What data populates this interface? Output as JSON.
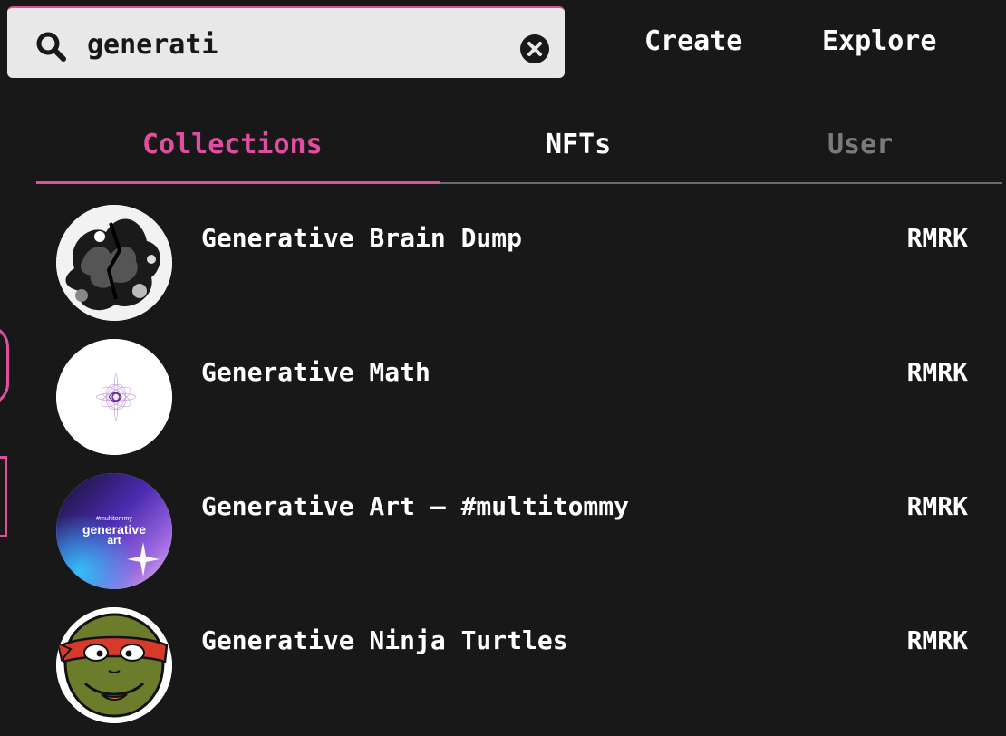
{
  "search": {
    "value": "generati",
    "placeholder": ""
  },
  "nav": {
    "create": "Create",
    "explore": "Explore"
  },
  "tabs": [
    {
      "label": "Collections",
      "state": "active"
    },
    {
      "label": "NFTs",
      "state": "inactive"
    },
    {
      "label": "User",
      "state": "disabled"
    }
  ],
  "results": [
    {
      "name": "Generative Brain Dump",
      "chain": "RMRK",
      "thumb_icon": "ink-blot-thumbnail"
    },
    {
      "name": "Generative Math",
      "chain": "RMRK",
      "thumb_icon": "math-swirl-thumbnail"
    },
    {
      "name": "Generative Art – #multitommy",
      "chain": "RMRK",
      "thumb_icon": "gradient-art-thumbnail",
      "thumb_text": {
        "small": "#multitommy",
        "line1": "generative",
        "line2": "art"
      }
    },
    {
      "name": "Generative Ninja Turtles",
      "chain": "RMRK",
      "thumb_icon": "ninja-turtle-thumbnail"
    }
  ],
  "colors": {
    "accent": "#e04f9e",
    "background": "#181818",
    "search_bg": "#e8e8e8",
    "inactive_tab": "#7a7a7a"
  }
}
